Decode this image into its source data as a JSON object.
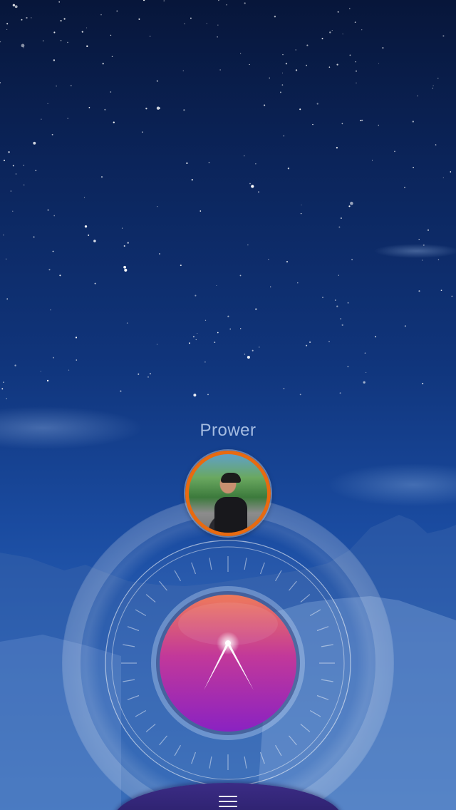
{
  "lock_screen": {
    "user_name": "Prower",
    "avatar_icon": "user-avatar",
    "dial_icon": "clock-hands-icon",
    "menu_icon": "hamburger-menu-icon",
    "colors": {
      "avatar_ring": "#e86a10",
      "dial_top": "#ef7a5a",
      "dial_mid": "#c2389a",
      "dial_bottom": "#8a22c2",
      "tab_bar": "#2d2270"
    }
  }
}
